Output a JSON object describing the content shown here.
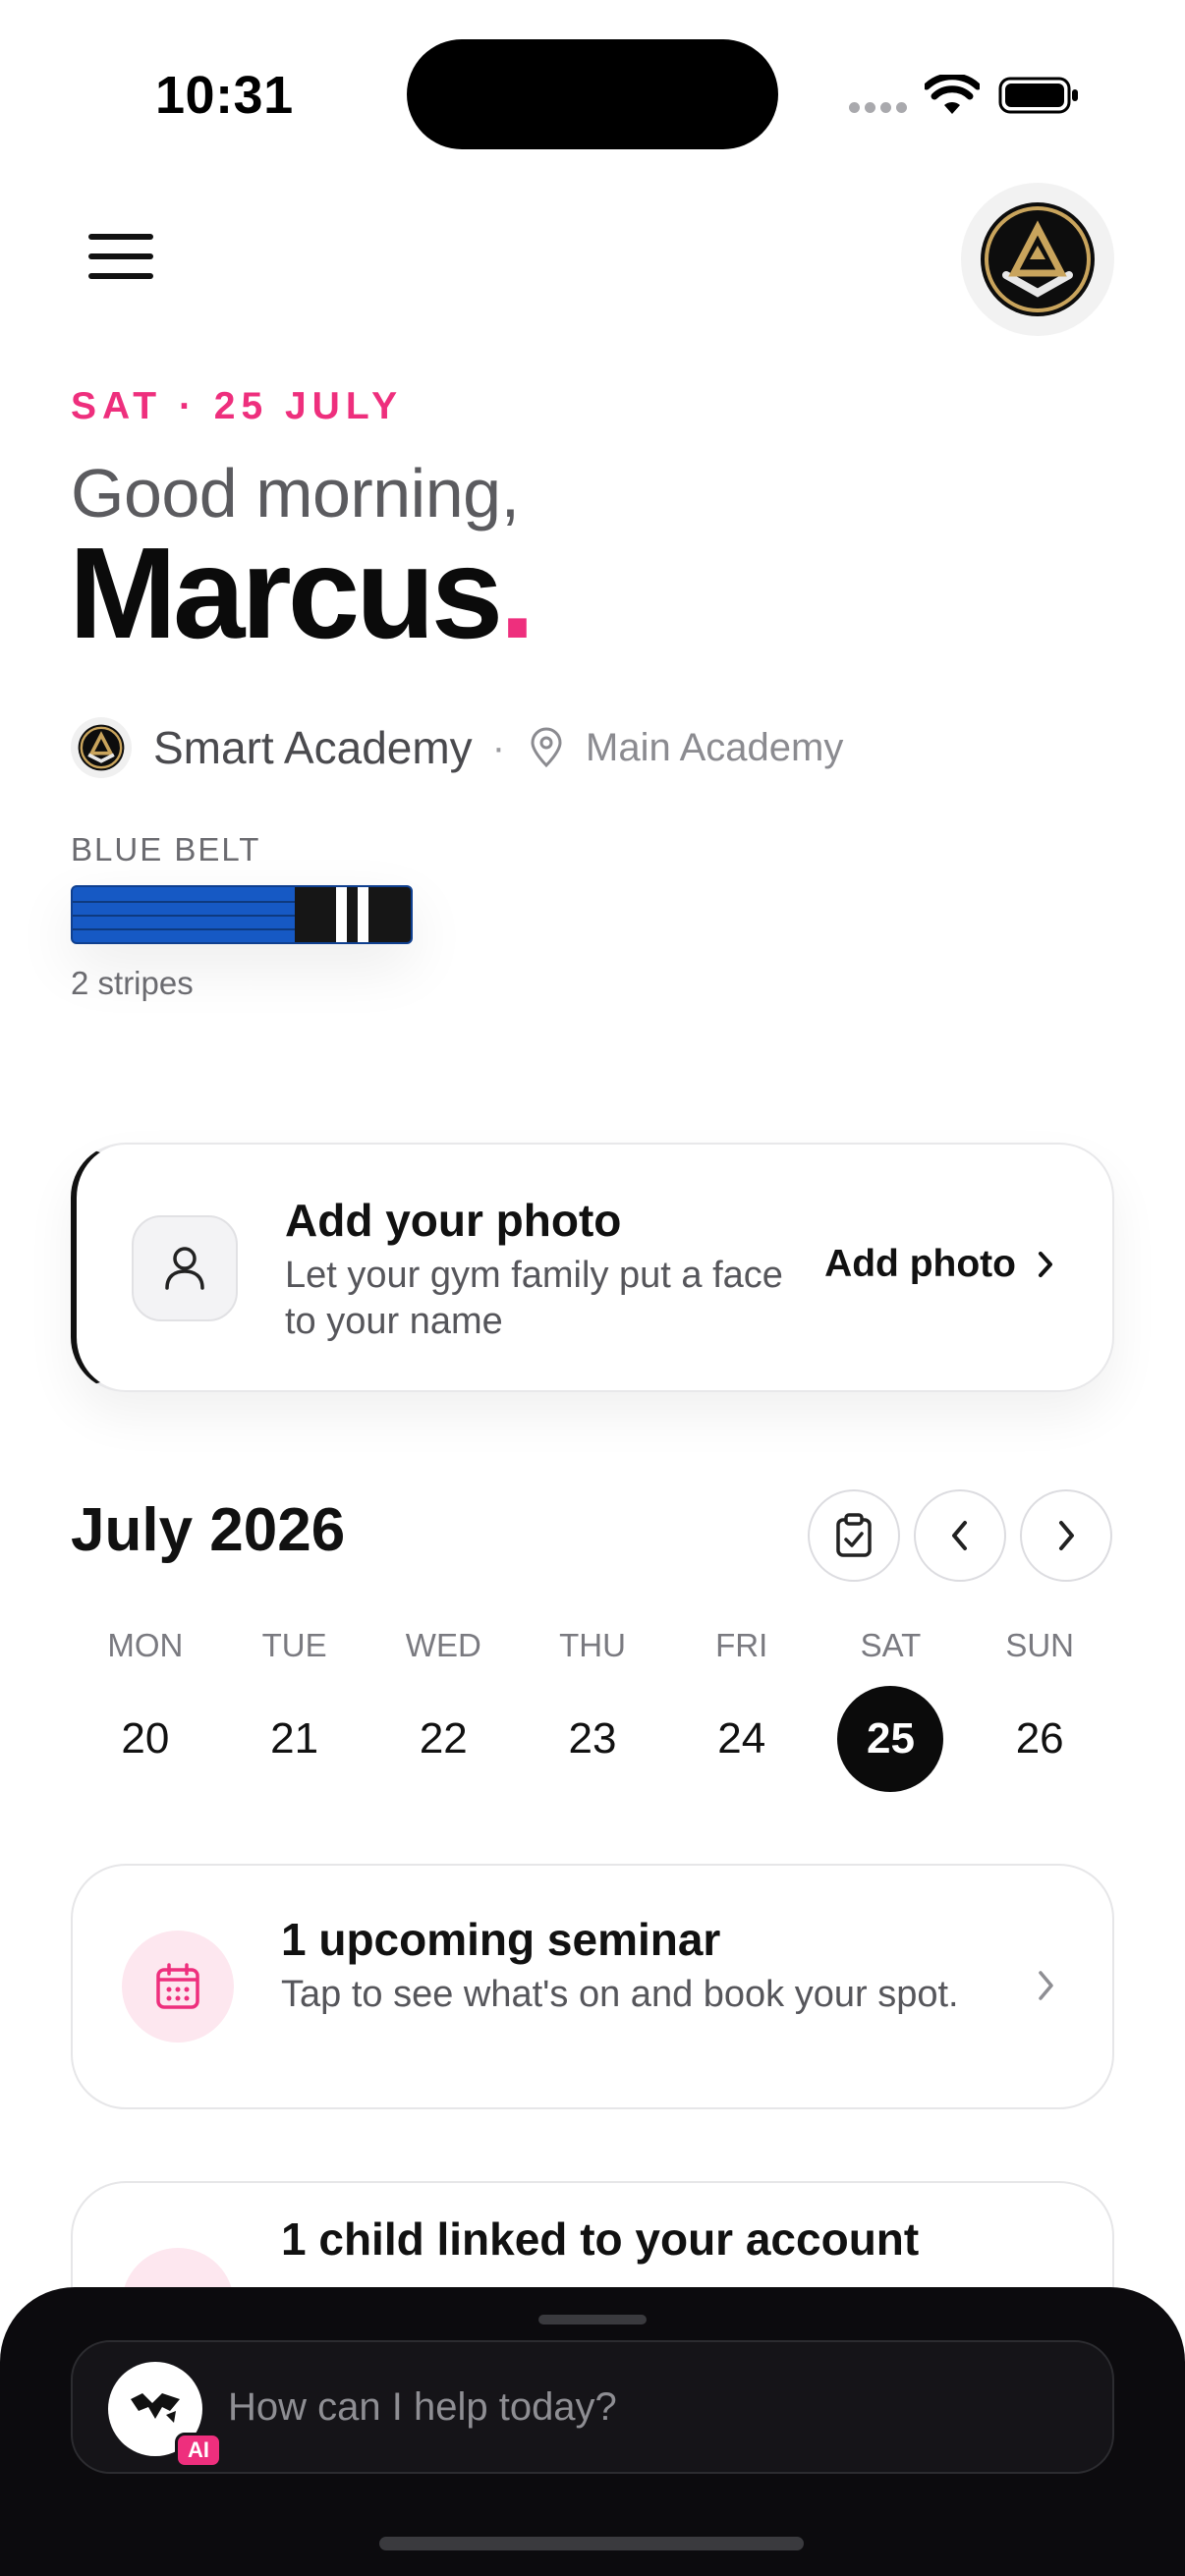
{
  "status_bar": {
    "time": "10:31"
  },
  "header": {
    "date_label": "SAT · 25 JULY",
    "greeting": "Good morning,",
    "name": "Marcus",
    "name_dot": "."
  },
  "academy": {
    "name": "Smart Academy",
    "separator": "·",
    "location": "Main Academy"
  },
  "belt": {
    "label": "BLUE BELT",
    "color": "#1659c4",
    "stripes_count": 2,
    "stripes_text": "2 stripes"
  },
  "photo_card": {
    "title": "Add your photo",
    "subtitle": "Let your gym family put a face to your name",
    "action_label": "Add photo"
  },
  "calendar": {
    "month": "July 2026",
    "weekdays": [
      "MON",
      "TUE",
      "WED",
      "THU",
      "FRI",
      "SAT",
      "SUN"
    ],
    "days": [
      "20",
      "21",
      "22",
      "23",
      "24",
      "25",
      "26"
    ],
    "selected_day": "25"
  },
  "seminar_card": {
    "title": "1 upcoming seminar",
    "subtitle": "Tap to see what's on and book your spot."
  },
  "child_card": {
    "title": "1 child linked to your account"
  },
  "assistant": {
    "badge": "AI",
    "placeholder": "How can I help today?"
  },
  "colors": {
    "accent": "#ee2f7d",
    "text": "#111111",
    "sheet": "#0c0b0e"
  }
}
